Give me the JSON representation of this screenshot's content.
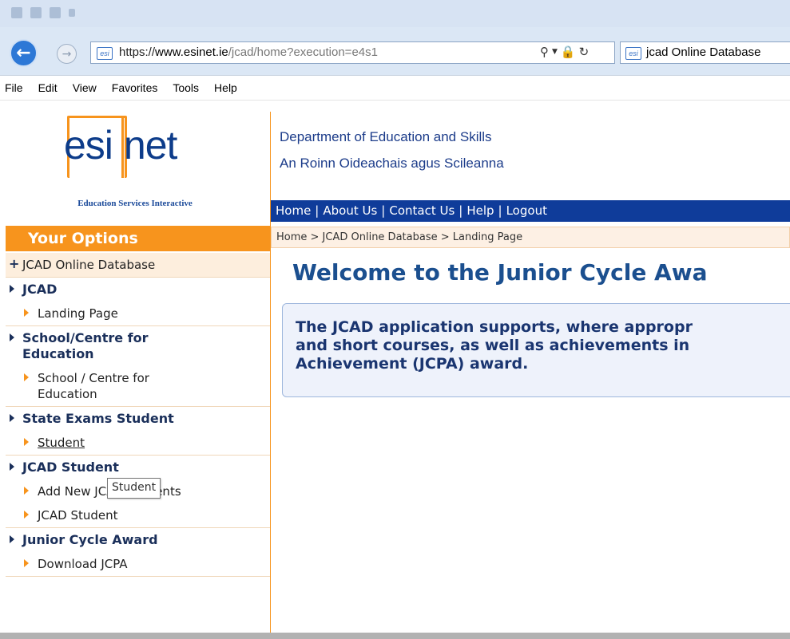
{
  "browser": {
    "url_protocol": "https://",
    "url_domain": "www.esinet.ie",
    "url_path": "/jcad/home?execution=e4s1",
    "tab_title": "jcad Online Database",
    "favicon_text": "esi",
    "menu": [
      "File",
      "Edit",
      "View",
      "Favorites",
      "Tools",
      "Help"
    ]
  },
  "logo": {
    "text_left": "esi",
    "text_right": "net",
    "tagline": "Education Services Interactive"
  },
  "dept": {
    "line1": "Department of Education and Skills",
    "line2": "An Roinn Oideachais agus Scileanna"
  },
  "topnav": {
    "items": [
      "Home",
      "About Us",
      "Contact Us",
      "Help",
      "Logout"
    ],
    "separator": "|"
  },
  "breadcrumb": "Home > JCAD Online Database > Landing Page",
  "main": {
    "welcome": "Welcome to the Junior Cycle Awa",
    "info_line1": "The JCAD application supports, where appropr",
    "info_line2": "and short courses, as well as achievements in",
    "info_line3": "Achievement (JCPA) award."
  },
  "sidebar": {
    "header": "Your Options",
    "plus_item": "JCAD Online Database",
    "sections": [
      {
        "title": "JCAD",
        "items": [
          "Landing Page"
        ]
      },
      {
        "title_line1": "School/Centre for",
        "title_line2": "Education",
        "item_line1": "School / Centre for",
        "item_line2": "Education"
      },
      {
        "title": "State Exams Student",
        "items": [
          "Student"
        ]
      },
      {
        "title": "JCAD Student",
        "items": [
          "Add New JCAD Students",
          "JCAD Student"
        ]
      },
      {
        "title": "Junior Cycle Award",
        "items": [
          "Download JCPA"
        ]
      }
    ]
  },
  "tooltip": "Student",
  "colors": {
    "accent_orange": "#f7941d",
    "nav_blue": "#0f3c9a",
    "heading_blue": "#1b4f8f"
  }
}
